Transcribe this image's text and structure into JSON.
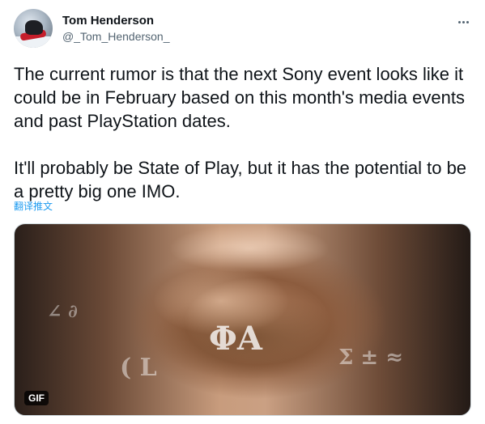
{
  "author": {
    "display_name": "Tom Henderson",
    "handle": "@_Tom_Henderson_",
    "avatar_icon": "avatar-snowmobile"
  },
  "more_icon": "more-horizontal-icon",
  "tweet": {
    "text": "The current rumor is that the next Sony event looks like it could be in February based on this month's media events and past PlayStation dates.\n\nIt'll probably be State of Play, but it has the potential to be a pretty big one IMO.",
    "translate_label": "翻译推文"
  },
  "media": {
    "badge": "GIF"
  },
  "colors": {
    "text_primary": "#0f1419",
    "text_secondary": "#536471",
    "link": "#1d9bf0"
  }
}
